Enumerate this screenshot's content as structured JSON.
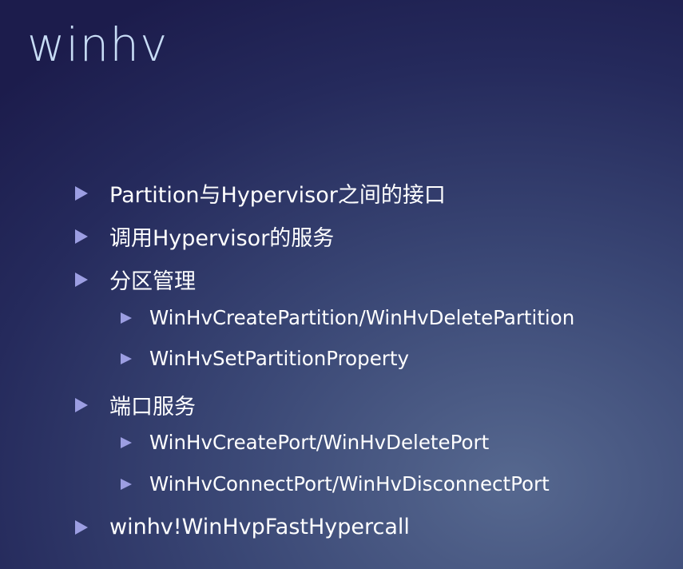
{
  "title": "winhv",
  "bullets": [
    {
      "level": 1,
      "text": "Partition与Hypervisor之间的接口"
    },
    {
      "level": 1,
      "text": "调用Hypervisor的服务"
    },
    {
      "level": 1,
      "text": "分区管理"
    },
    {
      "level": 2,
      "text": "WinHvCreatePartition/WinHvDeletePartition"
    },
    {
      "level": 2,
      "text": "WinHvSetPartitionProperty"
    },
    {
      "level": 1,
      "text": "端口服务"
    },
    {
      "level": 2,
      "text": "WinHvCreatePort/WinHvDeletePort"
    },
    {
      "level": 2,
      "text": "WinHvConnectPort/WinHvDisconnectPort"
    },
    {
      "level": 1,
      "text": "winhv!WinHvpFastHypercall"
    }
  ],
  "colors": {
    "title": "#c7dcf5",
    "bullet": "#9c9ee2",
    "text": "#ffffff"
  }
}
